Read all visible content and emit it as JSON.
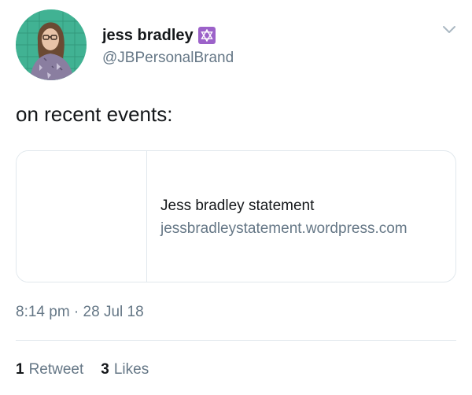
{
  "author": {
    "display_name": "jess bradley",
    "name_emoji": "star-of-david-icon",
    "handle": "@JBPersonalBrand"
  },
  "tweet": {
    "text": "on recent events:"
  },
  "card": {
    "title": "Jess bradley statement",
    "url": "jessbradleystatement.wordpress.com"
  },
  "meta": {
    "timestamp": "8:14 pm · 28 Jul 18"
  },
  "stats": {
    "retweets_count": "1",
    "retweets_label": "Retweet",
    "likes_count": "3",
    "likes_label": "Likes"
  },
  "colors": {
    "text_primary": "#14171a",
    "text_secondary": "#657786",
    "border": "#e1e8ed",
    "emoji_bg": "#9c62c9"
  }
}
